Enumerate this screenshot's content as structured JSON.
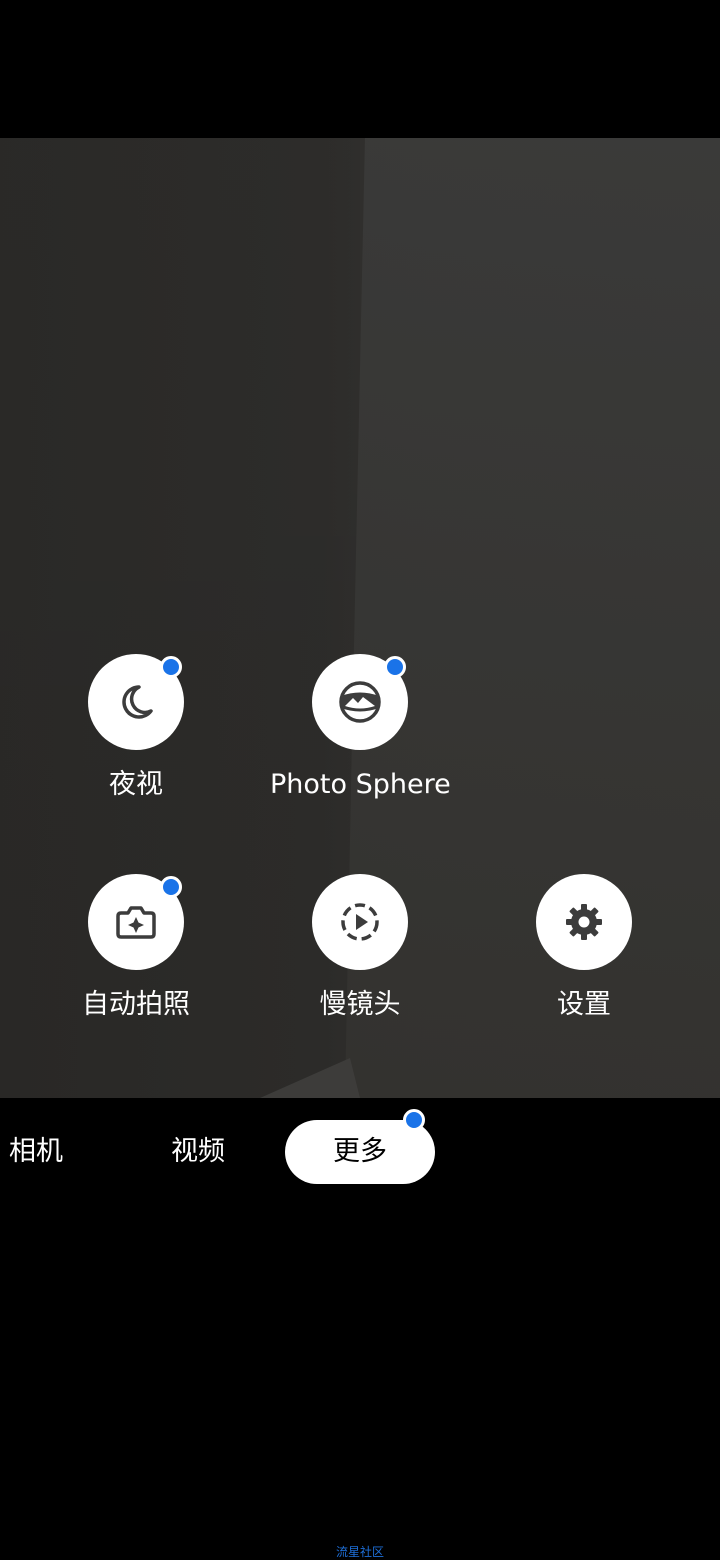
{
  "modes": [
    {
      "label": "夜视",
      "icon": "night-moon-icon",
      "badge": true
    },
    {
      "label": "Photo Sphere",
      "icon": "photo-sphere-icon",
      "badge": true
    },
    {
      "label": "自动拍照",
      "icon": "auto-shot-camera-icon",
      "badge": true
    },
    {
      "label": "慢镜头",
      "icon": "slow-motion-icon",
      "badge": false
    },
    {
      "label": "设置",
      "icon": "gear-icon",
      "badge": false
    }
  ],
  "tabs": {
    "camera": "相机",
    "video": "视频",
    "more": "更多"
  },
  "watermark": "流星社区",
  "colors": {
    "badge": "#1a73e8",
    "background": "#000000",
    "icon": "#3c3c3c"
  }
}
